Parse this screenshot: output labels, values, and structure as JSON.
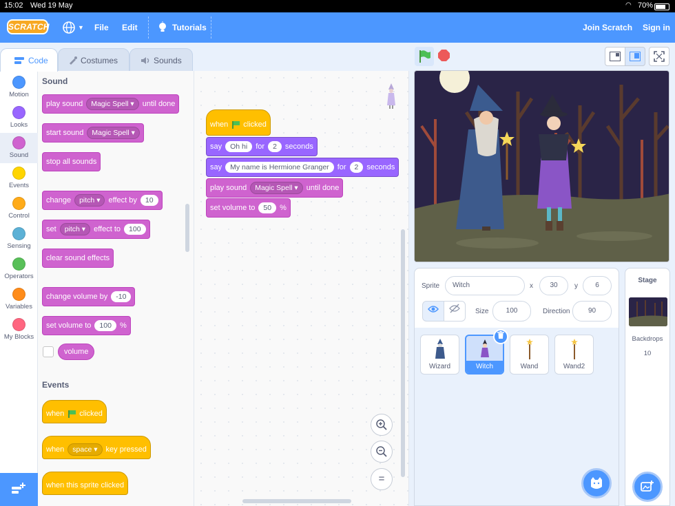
{
  "status_bar": {
    "time": "15:02",
    "date": "Wed 19 May",
    "battery": "70%"
  },
  "menu": {
    "logo": "SCRATCH",
    "file": "File",
    "edit": "Edit",
    "tutorials": "Tutorials",
    "join": "Join Scratch",
    "signin": "Sign in"
  },
  "tabs": {
    "code": "Code",
    "costumes": "Costumes",
    "sounds": "Sounds"
  },
  "categories": [
    {
      "label": "Motion",
      "color": "#4c97ff"
    },
    {
      "label": "Looks",
      "color": "#9966ff"
    },
    {
      "label": "Sound",
      "color": "#cf63cf"
    },
    {
      "label": "Events",
      "color": "#ffd500"
    },
    {
      "label": "Control",
      "color": "#ffab19"
    },
    {
      "label": "Sensing",
      "color": "#5cb1d6"
    },
    {
      "label": "Operators",
      "color": "#59c059"
    },
    {
      "label": "Variables",
      "color": "#ff8c1a"
    },
    {
      "label": "My Blocks",
      "color": "#ff6680"
    }
  ],
  "palette": {
    "sound_heading": "Sound",
    "play_until_done": {
      "a": "play sound",
      "sound": "Magic Spell",
      "b": "until done"
    },
    "start_sound": {
      "a": "start sound",
      "sound": "Magic Spell"
    },
    "stop_all": "stop all sounds",
    "change_effect": {
      "a": "change",
      "effect": "pitch",
      "b": "effect by",
      "value": "10"
    },
    "set_effect": {
      "a": "set",
      "effect": "pitch",
      "b": "effect to",
      "value": "100"
    },
    "clear_effects": "clear sound effects",
    "change_volume": {
      "a": "change volume by",
      "value": "-10"
    },
    "set_volume": {
      "a": "set volume to",
      "value": "100",
      "unit": "%"
    },
    "volume_reporter": "volume",
    "events_heading": "Events",
    "when_flag": {
      "a": "when",
      "b": "clicked"
    },
    "when_key": {
      "a": "when",
      "key": "space",
      "b": "key pressed"
    },
    "when_sprite": "when this sprite clicked"
  },
  "script": {
    "hat": {
      "a": "when",
      "b": "clicked"
    },
    "say1": {
      "a": "say",
      "msg": "Oh hi",
      "b": "for",
      "secs": "2",
      "c": "seconds"
    },
    "say2": {
      "a": "say",
      "msg": "My name is Hermione Granger",
      "b": "for",
      "secs": "2",
      "c": "seconds"
    },
    "play": {
      "a": "play sound",
      "sound": "Magic Spell",
      "b": "until done"
    },
    "volume": {
      "a": "set volume to",
      "value": "50",
      "unit": "%"
    }
  },
  "workspace_buttons": {
    "zoom_in": "+",
    "zoom_out": "−",
    "reset": "="
  },
  "sprite_info": {
    "sprite_label": "Sprite",
    "name": "Witch",
    "x_label": "x",
    "x": "30",
    "y_label": "y",
    "y": "6",
    "size_label": "Size",
    "size": "100",
    "direction_label": "Direction",
    "direction": "90"
  },
  "sprites": [
    {
      "name": "Wizard",
      "selected": false
    },
    {
      "name": "Witch",
      "selected": true
    },
    {
      "name": "Wand",
      "selected": false
    },
    {
      "name": "Wand2",
      "selected": false
    }
  ],
  "stage_selector": {
    "title": "Stage",
    "backdrops_label": "Backdrops",
    "backdrops_count": "10"
  },
  "colors": {
    "accent": "#4c97ff",
    "sound": "#cf63cf",
    "looks": "#9966ff",
    "events": "#ffbf00"
  }
}
